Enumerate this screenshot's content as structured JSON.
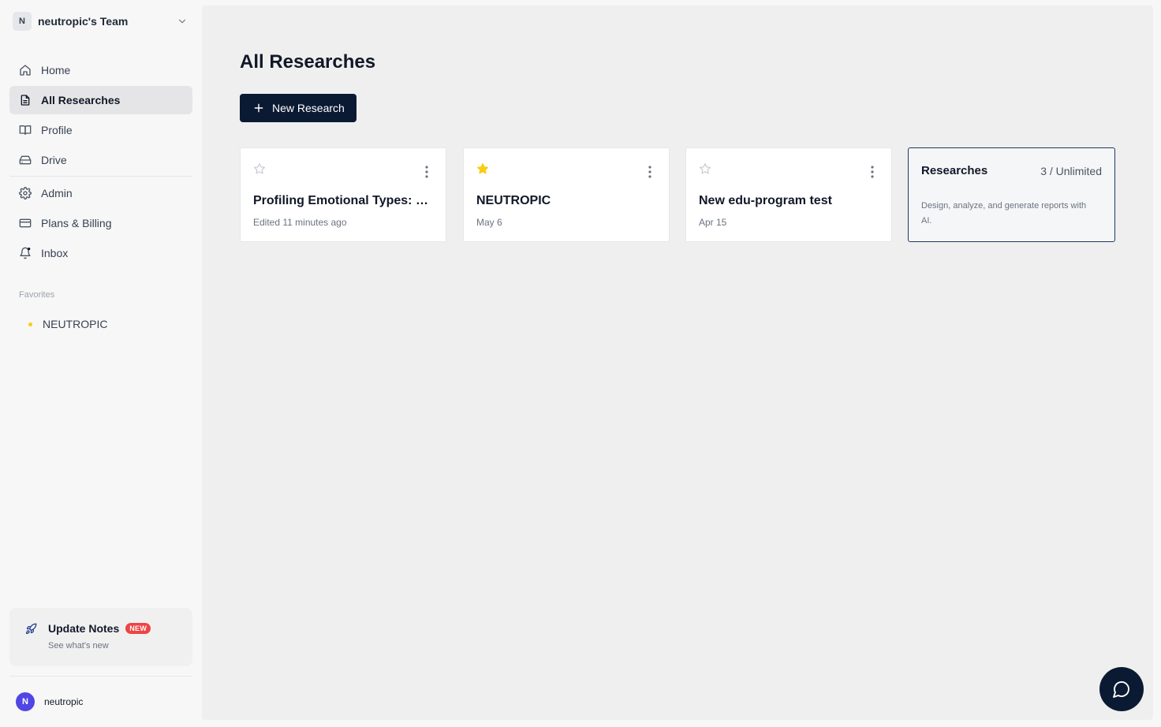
{
  "team": {
    "initial": "N",
    "name": "neutropic's Team"
  },
  "nav": {
    "home": "Home",
    "all_researches": "All Researches",
    "profile": "Profile",
    "drive": "Drive",
    "admin": "Admin",
    "plans_billing": "Plans & Billing",
    "inbox": "Inbox",
    "active_item": "All Researches"
  },
  "favorites": {
    "title": "Favorites",
    "items": [
      {
        "label": "NEUTROPIC"
      }
    ]
  },
  "update_notes": {
    "title": "Update Notes",
    "badge": "NEW",
    "subtitle": "See what's new"
  },
  "user": {
    "initial": "N",
    "name": "neutropic"
  },
  "main": {
    "title": "All Researches",
    "new_button": "New Research",
    "cards": [
      {
        "title": "Profiling Emotional Types: Di...",
        "date": "Edited 11 minutes ago",
        "favorited": false
      },
      {
        "title": "NEUTROPIC",
        "date": "May 6",
        "favorited": true
      },
      {
        "title": "New edu-program test",
        "date": "Apr 15",
        "favorited": false
      }
    ],
    "summary": {
      "title": "Researches",
      "count": "3 / Unlimited",
      "description": "Design, analyze, and generate reports with AI."
    }
  },
  "colors": {
    "primary": "#0b1a33",
    "favorite_star": "#facc15",
    "new_badge": "#ef4444",
    "user_avatar": "#4f46e5"
  },
  "icons": {
    "home": "home-icon",
    "all_researches": "document-icon",
    "profile": "book-open-icon",
    "drive": "drive-icon",
    "admin": "gear-icon",
    "plans_billing": "credit-card-icon",
    "inbox": "bell-icon",
    "update_notes": "rocket-icon",
    "chat": "chat-bubble-icon"
  }
}
